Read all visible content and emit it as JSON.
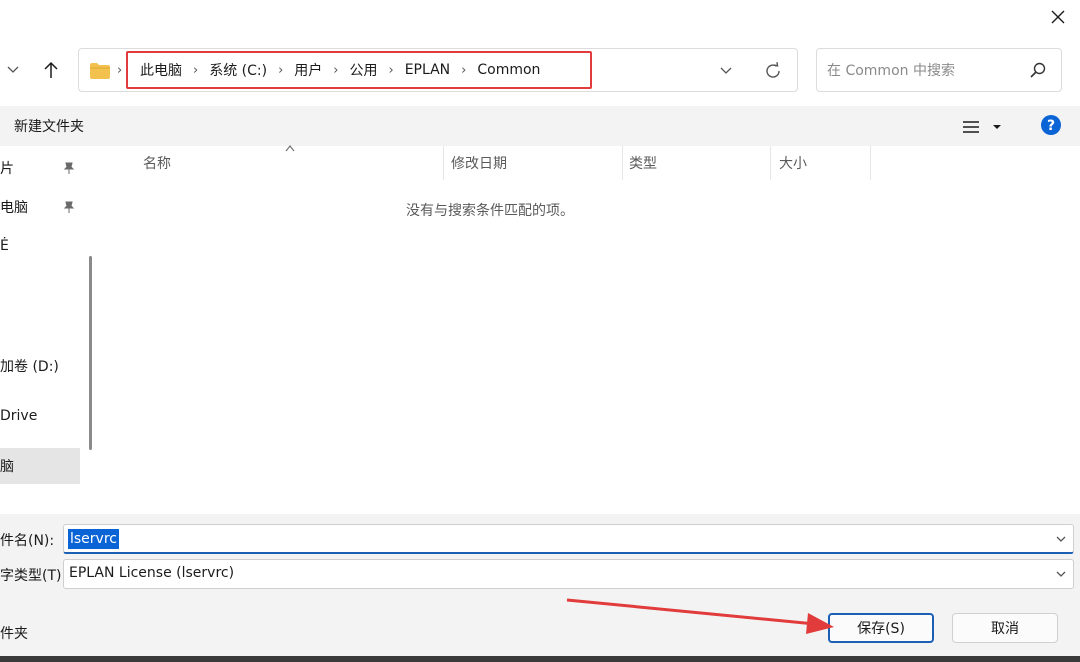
{
  "nav": {
    "breadcrumb": [
      "此电脑",
      "系统 (C:)",
      "用户",
      "公用",
      "EPLAN",
      "Common"
    ]
  },
  "search": {
    "placeholder": "在 Common 中搜索"
  },
  "toolbar": {
    "new_folder_label": "新建文件夹"
  },
  "sidebar": {
    "items": [
      {
        "label": "片"
      },
      {
        "label": "电脑"
      },
      {
        "label": "Ė"
      },
      {
        "label": "加卷 (D:)"
      },
      {
        "label": "Drive"
      },
      {
        "label": "脑"
      }
    ]
  },
  "file_list": {
    "columns": [
      "名称",
      "修改日期",
      "类型",
      "大小"
    ],
    "empty_message": "没有与搜索条件匹配的项。"
  },
  "form": {
    "filename_label": "件名(N):",
    "filename_value": "lservrc",
    "filetype_label": "字类型(T):",
    "filetype_value": "EPLAN License (lservrc)",
    "hide_folders_label": "件夹"
  },
  "buttons": {
    "save": "保存(S)",
    "cancel": "取消"
  },
  "colors": {
    "accent": "#1a5fb4",
    "highlight_box": "#e13b3b",
    "folder": "#f2c14e",
    "help": "#0a64d6"
  }
}
